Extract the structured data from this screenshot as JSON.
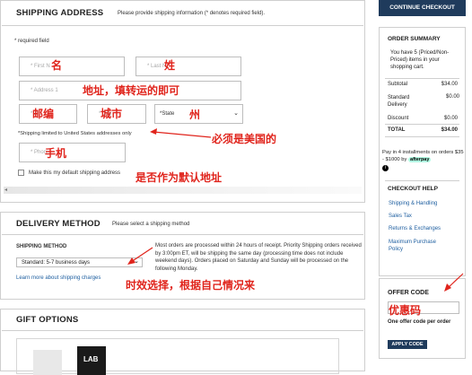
{
  "shipping": {
    "title": "SHIPPING ADDRESS",
    "instruction": "Please provide shipping information (* denotes required field).",
    "required_note": "* required field",
    "first_name_placeholder": "* First N",
    "last_name_placeholder": "* Last N",
    "address_placeholder": "* Address 1",
    "zip_placeholder": "* Zip",
    "city_placeholder": "* City",
    "state_value": "*State",
    "limit_note": "*Shipping limited to United States addresses only",
    "phone_placeholder": "* Phon",
    "default_checkbox_label": "Make this my default shipping address"
  },
  "annotations": {
    "name_first": "名",
    "name_last": "姓",
    "address": "地址，填转运的即可",
    "zip": "邮编",
    "city": "城市",
    "state": "州",
    "us_only": "必须是美国的",
    "phone": "手机",
    "default": "是否作为默认地址",
    "timing": "时效选择，根据自己情况来",
    "offer": "优惠码"
  },
  "delivery": {
    "title": "DELIVERY METHOD",
    "instruction": "Please select a shipping method",
    "method_label": "SHIPPING METHOD",
    "method_value": "Standard: 5-7 business days",
    "learn_more": "Learn more about shipping charges",
    "description": "Most orders are processed within 24 hours of receipt. Priority Shipping orders received by 3:00pm ET, will be shipping the same day (processing time does not include weekend days). Orders placed on Saturday and Sunday will be processed on the following Monday."
  },
  "gift": {
    "title": "GIFT OPTIONS",
    "bag_text": "LAB"
  },
  "checkout_button": "CONTINUE CHECKOUT",
  "order_summary": {
    "title": "ORDER SUMMARY",
    "items_text": "You have 5 (Priced/Non-Priced) items in your shopping cart.",
    "rows": [
      {
        "label": "Subtotal",
        "value": "$34.00"
      },
      {
        "label": "Standard Delivery",
        "value": "$0.00"
      },
      {
        "label": "Discount",
        "value": "$0.00"
      },
      {
        "label": "TOTAL",
        "value": "$34.00"
      }
    ],
    "pay_text": "Pay in 4 installments on orders $35 - $1000 by",
    "afterpay_label": "afterpay"
  },
  "checkout_help": {
    "title": "CHECKOUT HELP",
    "links": [
      "Shipping & Handling",
      "Sales Tax",
      "Returns & Exchanges",
      "Maximum Purchase Policy"
    ]
  },
  "offer": {
    "title": "OFFER CODE",
    "note": "One offer code per order",
    "apply_label": "APPLY CODE"
  }
}
